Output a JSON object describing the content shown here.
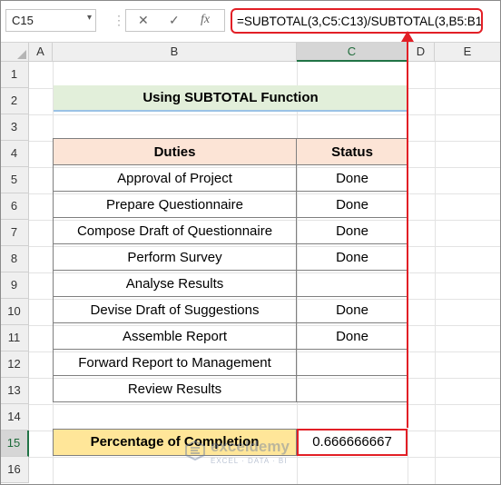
{
  "formula_bar": {
    "name_box": "C15",
    "cancel_icon": "✕",
    "enter_icon": "✓",
    "fx_label": "fx",
    "formula": "=SUBTOTAL(3,C5:C13)/SUBTOTAL(3,B5:B13)"
  },
  "columns": [
    "A",
    "B",
    "C",
    "D",
    "E"
  ],
  "rows": [
    "1",
    "2",
    "3",
    "4",
    "5",
    "6",
    "7",
    "8",
    "9",
    "10",
    "11",
    "12",
    "13",
    "14",
    "15",
    "16"
  ],
  "selected_cell": {
    "column": "C",
    "row": "15"
  },
  "sheet": {
    "title": "Using SUBTOTAL Function",
    "headers": {
      "duties": "Duties",
      "status": "Status"
    },
    "tasks": [
      {
        "duty": "Approval of Project",
        "status": "Done"
      },
      {
        "duty": "Prepare Questionnaire",
        "status": "Done"
      },
      {
        "duty": "Compose Draft of Questionnaire",
        "status": "Done"
      },
      {
        "duty": "Perform Survey",
        "status": "Done"
      },
      {
        "duty": "Analyse Results",
        "status": ""
      },
      {
        "duty": "Devise Draft of Suggestions",
        "status": "Done"
      },
      {
        "duty": "Assemble Report",
        "status": "Done"
      },
      {
        "duty": "Forward Report to Management",
        "status": ""
      },
      {
        "duty": "Review Results",
        "status": ""
      }
    ],
    "percentage_label": "Percentage of Completion",
    "percentage_value": "0.666666667"
  },
  "watermark": {
    "name": "exceldemy",
    "tagline": "EXCEL · DATA · BI"
  },
  "colors": {
    "highlight_red": "#e21f26",
    "title_fill": "#e2efda",
    "header_fill": "#fce4d6",
    "label_fill": "#ffe699"
  }
}
